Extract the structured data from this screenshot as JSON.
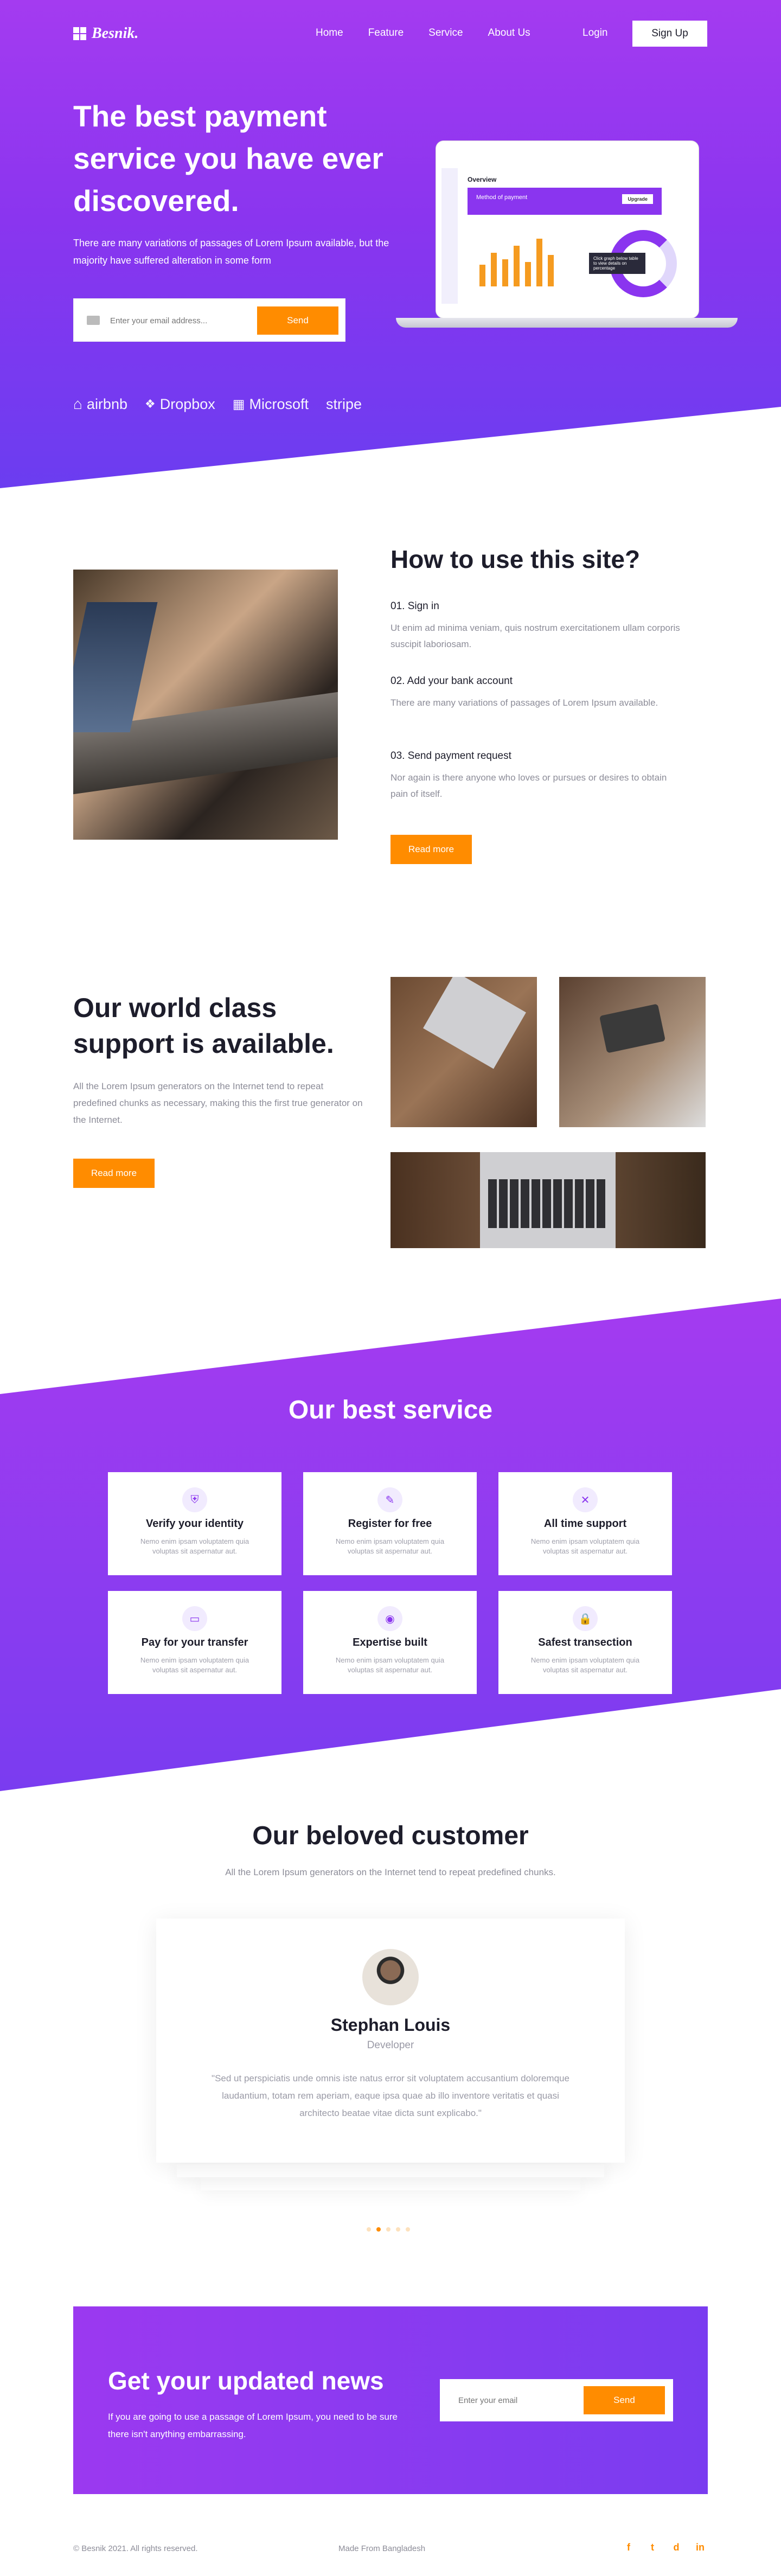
{
  "nav": {
    "logo": "Besnik.",
    "links": [
      "Home",
      "Feature",
      "Service",
      "About Us"
    ],
    "login": "Login",
    "signup": "Sign Up"
  },
  "hero": {
    "title": "The best payment service you have ever discovered.",
    "subtitle": "There are many variations of passages of Lorem Ipsum available, but the majority have suffered alteration in some form",
    "email_placeholder": "Enter your email address...",
    "send": "Send",
    "brands": [
      "airbnb",
      "Dropbox",
      "Microsoft",
      "stripe"
    ],
    "mockup": {
      "overview": "Overview",
      "method": "Method of payment",
      "upgrade": "Upgrade",
      "tooltip": "Click graph below table to view details on percentage"
    }
  },
  "how": {
    "title": "How to use this site?",
    "steps": [
      {
        "title": "01.  Sign in",
        "desc": "Ut enim ad minima veniam, quis nostrum exercitationem ullam corporis suscipit laboriosam."
      },
      {
        "title": "02.  Add your bank account",
        "desc": "There are many variations of passages of Lorem Ipsum available."
      },
      {
        "title": "03.  Send payment request",
        "desc": "Nor again is there anyone who loves or pursues or desires to obtain pain of itself."
      }
    ],
    "read_more": "Read more"
  },
  "support": {
    "title": "Our world class support is available.",
    "desc": "All the Lorem Ipsum generators on the Internet tend to repeat predefined chunks as necessary, making this the first true generator on the Internet.",
    "read_more": "Read more"
  },
  "service": {
    "title": "Our best service",
    "cards": [
      {
        "icon": "shield-icon",
        "title": "Verify your identity",
        "desc": "Nemo enim ipsam voluptatem quia voluptas sit aspernatur aut."
      },
      {
        "icon": "edit-icon",
        "title": "Register for free",
        "desc": "Nemo enim ipsam voluptatem quia voluptas sit aspernatur aut."
      },
      {
        "icon": "tools-icon",
        "title": "All time support",
        "desc": "Nemo enim ipsam voluptatem quia voluptas sit aspernatur aut."
      },
      {
        "icon": "card-icon",
        "title": "Pay for your transfer",
        "desc": "Nemo enim ipsam voluptatem quia voluptas sit aspernatur aut."
      },
      {
        "icon": "eye-icon",
        "title": "Expertise built",
        "desc": "Nemo enim ipsam voluptatem quia voluptas sit aspernatur aut."
      },
      {
        "icon": "lock-icon",
        "title": "Safest transection",
        "desc": "Nemo enim ipsam voluptatem quia voluptas sit aspernatur aut."
      }
    ]
  },
  "customer": {
    "title": "Our beloved customer",
    "subtitle": "All the Lorem Ipsum generators on the Internet tend to repeat predefined chunks.",
    "name": "Stephan Louis",
    "role": "Developer",
    "quote": "\"Sed ut perspiciatis unde omnis iste natus error sit voluptatem accusantium doloremque laudantium, totam rem aperiam, eaque ipsa quae ab illo inventore veritatis et quasi architecto beatae vitae dicta sunt explicabo.\""
  },
  "news": {
    "title": "Get your updated news",
    "desc": "If you are going to use a passage of Lorem Ipsum, you need to be sure there isn't anything embarrassing.",
    "placeholder": "Enter your email",
    "send": "Send"
  },
  "footer": {
    "copyright": "© Besnik 2021. All rights reserved.",
    "made": "Made From Bangladesh",
    "social": [
      "f",
      "t",
      "d",
      "in"
    ]
  },
  "colors": {
    "primary": "#8a35ef",
    "accent": "#ff8c00"
  }
}
